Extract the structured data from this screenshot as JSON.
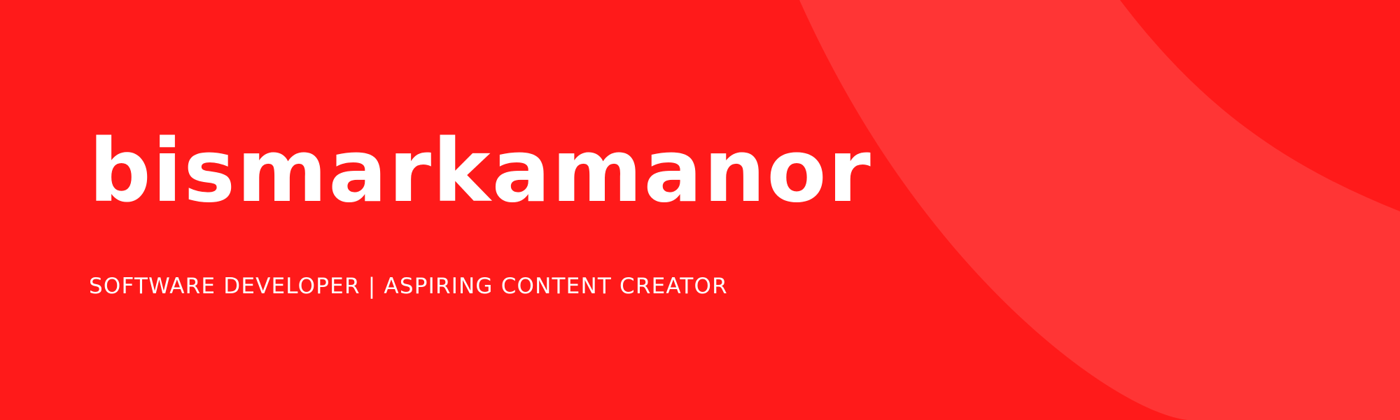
{
  "colors": {
    "background": "#ff1a1a",
    "accent_shape": "#ff3535",
    "text": "#ffffff"
  },
  "banner": {
    "title": "bismarkamanor",
    "tagline": "SOFTWARE DEVELOPER | ASPIRING CONTENT CREATOR"
  }
}
